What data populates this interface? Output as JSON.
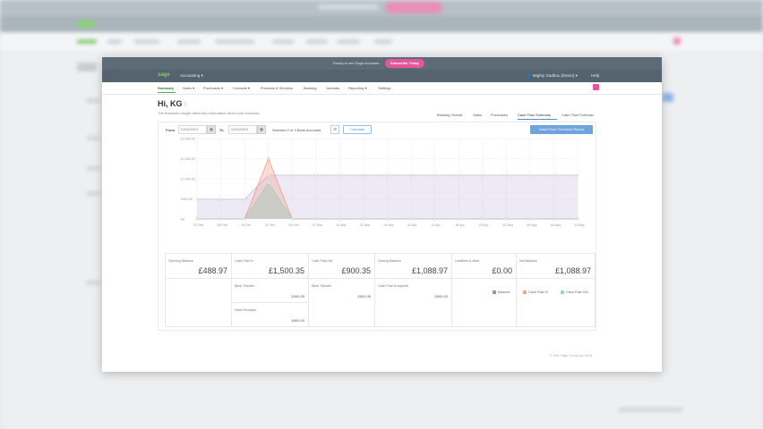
{
  "banner": {
    "message": "Ready to see Sage Accounts",
    "cta": "Subscribe Today"
  },
  "topbar": {
    "logo": "sage",
    "app": "Accounting ▾",
    "user": "Mighty Gadbox (Demo) ▾",
    "help": "Help"
  },
  "nav": {
    "items": [
      "Summary",
      "Sales ▾",
      "Purchases ▾",
      "Contacts ▾",
      "Products & Services",
      "Banking",
      "Journals",
      "Reporting ▾",
      "Settings"
    ]
  },
  "page": {
    "greeting": "Hi, KG",
    "subtitle": "The Business Insight offers key information about your business.",
    "tabs": [
      "Banking Overall",
      "Sales",
      "Purchases",
      "Cash Flow Summary",
      "Cash Flow Forecast"
    ],
    "active_tab": "Cash Flow Summary"
  },
  "controls": {
    "from_label": "From",
    "from_date": "01/01/2019",
    "to_label": "To",
    "to_date": "01/01/2019",
    "accounts_label": "Selected 2 of 3 Bank Accounts",
    "calc_label": "Calculate",
    "report_button": "Cash Flow Threshold Report"
  },
  "chart_data": {
    "type": "line",
    "x": [
      "01 Feb",
      "08 Feb",
      "15 Feb",
      "22 Feb",
      "29 Feb",
      "07 Mar",
      "14 Mar",
      "21 Mar",
      "28 Mar",
      "04 Apr",
      "11 Apr",
      "18 Apr",
      "25 Apr",
      "02 May",
      "09 May",
      "16 May",
      "23 May"
    ],
    "yticks": [
      "£2,000.00",
      "£1,500.00",
      "£1,000.00",
      "£500.00",
      "£0"
    ],
    "ylim": [
      0,
      2000
    ],
    "series": [
      {
        "name": "Balance",
        "color": "#c8c1da",
        "values": [
          488.97,
          488.97,
          488.97,
          1088.97,
          1088.97,
          1088.97,
          1088.97,
          1088.97,
          1088.97,
          1088.97,
          1088.97,
          1088.97,
          1088.97,
          1088.97,
          1088.97,
          1088.97,
          1088.97
        ]
      },
      {
        "name": "Cash Paid In",
        "color": "#f0a08c",
        "values": [
          0,
          0,
          0,
          1500.35,
          0,
          0,
          0,
          0,
          0,
          0,
          0,
          0,
          0,
          0,
          0,
          0,
          0
        ]
      },
      {
        "name": "Cash Paid Out",
        "color": "#b8d2c8",
        "values": [
          0,
          0,
          0,
          900.35,
          0,
          0,
          0,
          0,
          0,
          0,
          0,
          0,
          0,
          0,
          0,
          0,
          0
        ]
      }
    ],
    "grid": true,
    "legend": "bottom-right"
  },
  "summary": {
    "columns": [
      {
        "label": "Opening Balance",
        "value": "£488.97"
      },
      {
        "label": "Cash Paid In",
        "value": "£1,500.35"
      },
      {
        "label": "Cash Paid Out",
        "value": "£900.35"
      },
      {
        "label": "Closing Balance",
        "value": "£1,088.97"
      },
      {
        "label": "Liabilities & other",
        "value": "£0.00"
      },
      {
        "label": "Net Balance",
        "value": "£1,088.97"
      }
    ],
    "sub_rows": [
      {
        "col": 1,
        "label": "Bank Transfer",
        "value": "£900.35"
      },
      {
        "col": 2,
        "label": "Bank Transfer",
        "value": "£900.35"
      },
      {
        "col": 3,
        "label": "Cash Paid to supplier",
        "value": "£600.00"
      },
      {
        "col": 1,
        "label": "Sales Receipts",
        "value": "£600.00"
      }
    ]
  },
  "footer": "© The Sage Group plc 2019"
}
